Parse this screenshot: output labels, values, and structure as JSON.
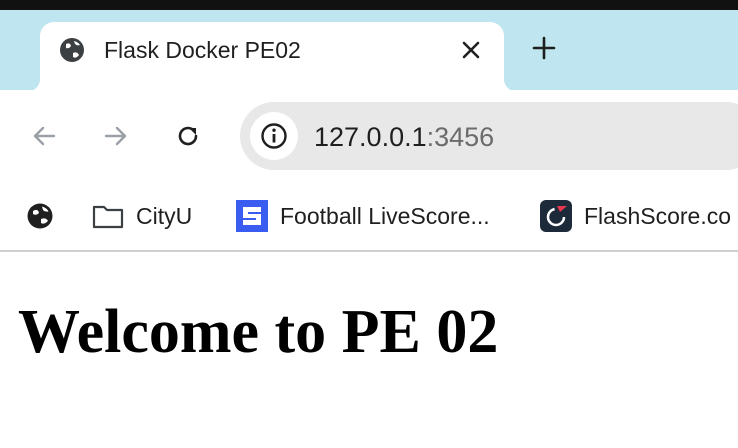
{
  "tab": {
    "title": "Flask Docker PE02"
  },
  "address_bar": {
    "host": "127.0.0.1",
    "port": ":3456"
  },
  "bookmarks": [
    {
      "label": "",
      "icon": "globe-icon"
    },
    {
      "label": "CityU",
      "icon": "folder-icon"
    },
    {
      "label": "Football LiveScore...",
      "icon": "livescore-logo-icon"
    },
    {
      "label": "FlashScore.co",
      "icon": "flashscore-logo-icon"
    }
  ],
  "page": {
    "heading": "Welcome to PE 02"
  },
  "colors": {
    "tabstrip": "#bfe5f0",
    "omnibox": "#e8e8e8",
    "livescore_blue": "#3b5cf0",
    "flashscore_bg": "#1d2a3a"
  }
}
